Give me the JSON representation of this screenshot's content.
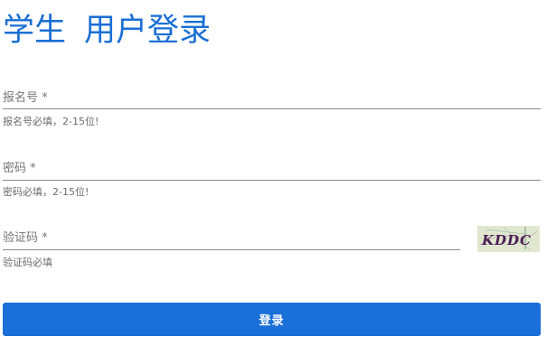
{
  "header": {
    "title_part1": "学生",
    "title_part2": "用户登录"
  },
  "form": {
    "registration_number": {
      "label": "报名号 *",
      "value": "",
      "hint": "报名号必填，2-15位!"
    },
    "password": {
      "label": "密码 *",
      "value": "",
      "hint": "密码必填，2-15位!"
    },
    "captcha": {
      "label": "验证码 *",
      "value": "",
      "hint": "验证码必填",
      "image_text": "KDDC"
    },
    "submit_label": "登录"
  },
  "colors": {
    "accent": "#1a6fd4",
    "button": "#1a6fd9",
    "captcha_background": "#dfe7cf",
    "captcha_text": "#4b1e54"
  }
}
